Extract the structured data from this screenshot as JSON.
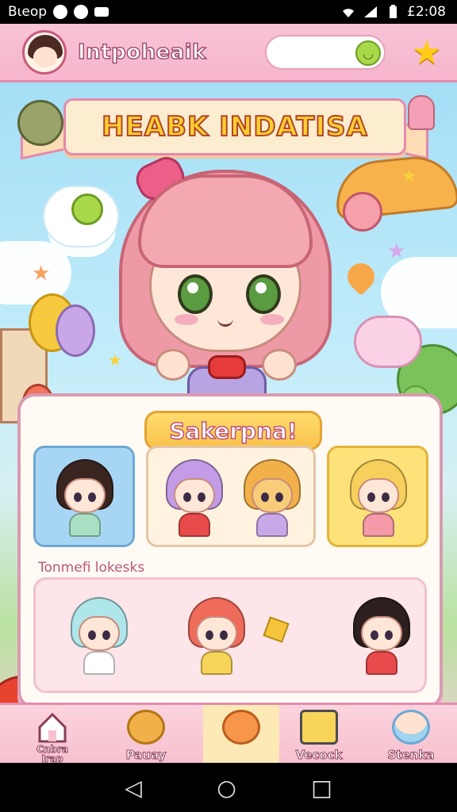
{
  "status_bar": {
    "left_text": "Bιeop",
    "time": "£2:08"
  },
  "header": {
    "title": "Intpoheaik",
    "search_placeholder": ""
  },
  "banner": {
    "title": "HEABK INDATISA"
  },
  "panel": {
    "title": "Sakerpna!",
    "section_label": "Tonmefi lokesks"
  },
  "bottom_nav": {
    "items": [
      {
        "label": "Cnbra\nIrap"
      },
      {
        "label": "Pauay"
      },
      {
        "label": ""
      },
      {
        "label": "Vecock"
      },
      {
        "label": "Stenka"
      }
    ]
  },
  "colors": {
    "header_pink": "#f9c3d6",
    "accent_pink": "#e58aac",
    "banner_gold": "#ffcf2e",
    "panel_bg": "#fffaf3"
  },
  "icons": {
    "header_smiley": "smiley-icon",
    "header_star": "star-icon",
    "nav_home": "home-icon"
  },
  "glyphs": {
    "star": "★",
    "smile": "◡",
    "sys_back": "◁",
    "sys_home": "○",
    "sys_recent": "□"
  }
}
